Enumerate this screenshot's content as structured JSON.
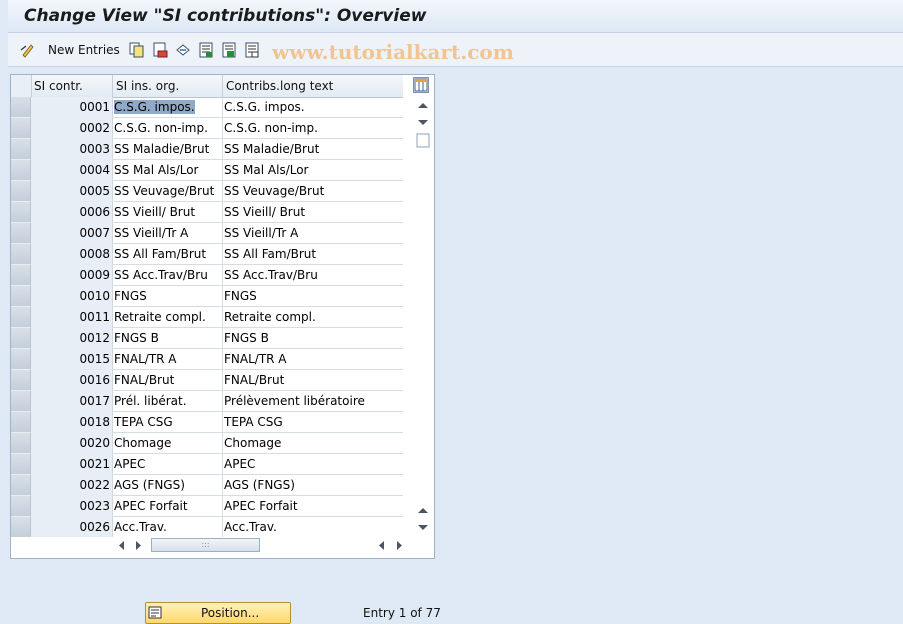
{
  "window": {
    "title": "Change View \"SI contributions\": Overview"
  },
  "toolbar": {
    "new_entries_label": "New Entries",
    "icons": [
      "edit-toggle-icon",
      "copy-icon",
      "delete-icon",
      "undo-change-icon",
      "select-all-icon",
      "select-block-icon",
      "deselect-all-icon"
    ]
  },
  "watermark": "www.tutorialkart.com",
  "table": {
    "columns": [
      "SI contr.",
      "SI ins. org.",
      "Contribs.long text"
    ],
    "rows": [
      {
        "code": "0001",
        "org": "C.S.G. impos.",
        "text": "C.S.G. impos."
      },
      {
        "code": "0002",
        "org": "C.S.G. non-imp.",
        "text": "C.S.G. non-imp."
      },
      {
        "code": "0003",
        "org": "SS Maladie/Brut",
        "text": "SS Maladie/Brut"
      },
      {
        "code": "0004",
        "org": "SS Mal Als/Lor",
        "text": "SS Mal Als/Lor"
      },
      {
        "code": "0005",
        "org": "SS Veuvage/Brut",
        "text": "SS Veuvage/Brut"
      },
      {
        "code": "0006",
        "org": "SS Vieill/ Brut",
        "text": "SS Vieill/ Brut"
      },
      {
        "code": "0007",
        "org": "SS Vieill/Tr A",
        "text": "SS Vieill/Tr A"
      },
      {
        "code": "0008",
        "org": "SS All Fam/Brut",
        "text": "SS All Fam/Brut"
      },
      {
        "code": "0009",
        "org": "SS Acc.Trav/Bru",
        "text": "SS Acc.Trav/Bru"
      },
      {
        "code": "0010",
        "org": "FNGS",
        "text": "FNGS"
      },
      {
        "code": "0011",
        "org": "Retraite compl.",
        "text": "Retraite compl."
      },
      {
        "code": "0012",
        "org": "FNGS B",
        "text": "FNGS B"
      },
      {
        "code": "0015",
        "org": "FNAL/TR A",
        "text": "FNAL/TR A"
      },
      {
        "code": "0016",
        "org": "FNAL/Brut",
        "text": "FNAL/Brut"
      },
      {
        "code": "0017",
        "org": "Prél. libérat.",
        "text": "Prélèvement libératoire"
      },
      {
        "code": "0018",
        "org": "TEPA CSG",
        "text": "TEPA CSG"
      },
      {
        "code": "0020",
        "org": "Chomage",
        "text": "Chomage"
      },
      {
        "code": "0021",
        "org": "APEC",
        "text": "APEC"
      },
      {
        "code": "0022",
        "org": "AGS (FNGS)",
        "text": "AGS (FNGS)"
      },
      {
        "code": "0023",
        "org": "APEC Forfait",
        "text": "APEC Forfait"
      },
      {
        "code": "0026",
        "org": "Acc.Trav.",
        "text": "Acc.Trav."
      }
    ],
    "selected_row_index": 0
  },
  "footer": {
    "position_button_label": "Position...",
    "entry_text": "Entry 1 of 77"
  }
}
